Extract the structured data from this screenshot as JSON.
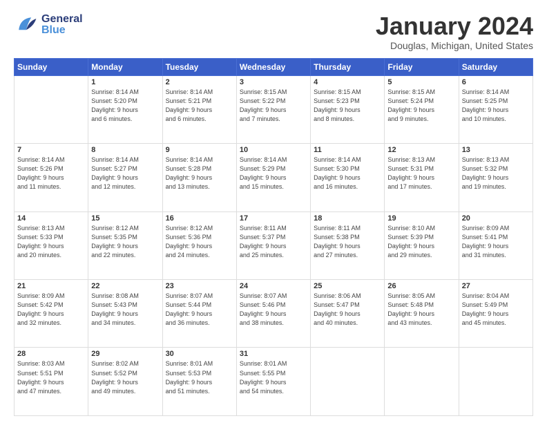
{
  "header": {
    "logo_general": "General",
    "logo_blue": "Blue",
    "month_title": "January 2024",
    "location": "Douglas, Michigan, United States"
  },
  "weekdays": [
    "Sunday",
    "Monday",
    "Tuesday",
    "Wednesday",
    "Thursday",
    "Friday",
    "Saturday"
  ],
  "weeks": [
    [
      {
        "day": "",
        "sunrise": "",
        "sunset": "",
        "daylight": ""
      },
      {
        "day": "1",
        "sunrise": "Sunrise: 8:14 AM",
        "sunset": "Sunset: 5:20 PM",
        "daylight": "Daylight: 9 hours and 6 minutes."
      },
      {
        "day": "2",
        "sunrise": "Sunrise: 8:14 AM",
        "sunset": "Sunset: 5:21 PM",
        "daylight": "Daylight: 9 hours and 6 minutes."
      },
      {
        "day": "3",
        "sunrise": "Sunrise: 8:15 AM",
        "sunset": "Sunset: 5:22 PM",
        "daylight": "Daylight: 9 hours and 7 minutes."
      },
      {
        "day": "4",
        "sunrise": "Sunrise: 8:15 AM",
        "sunset": "Sunset: 5:23 PM",
        "daylight": "Daylight: 9 hours and 8 minutes."
      },
      {
        "day": "5",
        "sunrise": "Sunrise: 8:15 AM",
        "sunset": "Sunset: 5:24 PM",
        "daylight": "Daylight: 9 hours and 9 minutes."
      },
      {
        "day": "6",
        "sunrise": "Sunrise: 8:14 AM",
        "sunset": "Sunset: 5:25 PM",
        "daylight": "Daylight: 9 hours and 10 minutes."
      }
    ],
    [
      {
        "day": "7",
        "sunrise": "Sunrise: 8:14 AM",
        "sunset": "Sunset: 5:26 PM",
        "daylight": "Daylight: 9 hours and 11 minutes."
      },
      {
        "day": "8",
        "sunrise": "Sunrise: 8:14 AM",
        "sunset": "Sunset: 5:27 PM",
        "daylight": "Daylight: 9 hours and 12 minutes."
      },
      {
        "day": "9",
        "sunrise": "Sunrise: 8:14 AM",
        "sunset": "Sunset: 5:28 PM",
        "daylight": "Daylight: 9 hours and 13 minutes."
      },
      {
        "day": "10",
        "sunrise": "Sunrise: 8:14 AM",
        "sunset": "Sunset: 5:29 PM",
        "daylight": "Daylight: 9 hours and 15 minutes."
      },
      {
        "day": "11",
        "sunrise": "Sunrise: 8:14 AM",
        "sunset": "Sunset: 5:30 PM",
        "daylight": "Daylight: 9 hours and 16 minutes."
      },
      {
        "day": "12",
        "sunrise": "Sunrise: 8:13 AM",
        "sunset": "Sunset: 5:31 PM",
        "daylight": "Daylight: 9 hours and 17 minutes."
      },
      {
        "day": "13",
        "sunrise": "Sunrise: 8:13 AM",
        "sunset": "Sunset: 5:32 PM",
        "daylight": "Daylight: 9 hours and 19 minutes."
      }
    ],
    [
      {
        "day": "14",
        "sunrise": "Sunrise: 8:13 AM",
        "sunset": "Sunset: 5:33 PM",
        "daylight": "Daylight: 9 hours and 20 minutes."
      },
      {
        "day": "15",
        "sunrise": "Sunrise: 8:12 AM",
        "sunset": "Sunset: 5:35 PM",
        "daylight": "Daylight: 9 hours and 22 minutes."
      },
      {
        "day": "16",
        "sunrise": "Sunrise: 8:12 AM",
        "sunset": "Sunset: 5:36 PM",
        "daylight": "Daylight: 9 hours and 24 minutes."
      },
      {
        "day": "17",
        "sunrise": "Sunrise: 8:11 AM",
        "sunset": "Sunset: 5:37 PM",
        "daylight": "Daylight: 9 hours and 25 minutes."
      },
      {
        "day": "18",
        "sunrise": "Sunrise: 8:11 AM",
        "sunset": "Sunset: 5:38 PM",
        "daylight": "Daylight: 9 hours and 27 minutes."
      },
      {
        "day": "19",
        "sunrise": "Sunrise: 8:10 AM",
        "sunset": "Sunset: 5:39 PM",
        "daylight": "Daylight: 9 hours and 29 minutes."
      },
      {
        "day": "20",
        "sunrise": "Sunrise: 8:09 AM",
        "sunset": "Sunset: 5:41 PM",
        "daylight": "Daylight: 9 hours and 31 minutes."
      }
    ],
    [
      {
        "day": "21",
        "sunrise": "Sunrise: 8:09 AM",
        "sunset": "Sunset: 5:42 PM",
        "daylight": "Daylight: 9 hours and 32 minutes."
      },
      {
        "day": "22",
        "sunrise": "Sunrise: 8:08 AM",
        "sunset": "Sunset: 5:43 PM",
        "daylight": "Daylight: 9 hours and 34 minutes."
      },
      {
        "day": "23",
        "sunrise": "Sunrise: 8:07 AM",
        "sunset": "Sunset: 5:44 PM",
        "daylight": "Daylight: 9 hours and 36 minutes."
      },
      {
        "day": "24",
        "sunrise": "Sunrise: 8:07 AM",
        "sunset": "Sunset: 5:46 PM",
        "daylight": "Daylight: 9 hours and 38 minutes."
      },
      {
        "day": "25",
        "sunrise": "Sunrise: 8:06 AM",
        "sunset": "Sunset: 5:47 PM",
        "daylight": "Daylight: 9 hours and 40 minutes."
      },
      {
        "day": "26",
        "sunrise": "Sunrise: 8:05 AM",
        "sunset": "Sunset: 5:48 PM",
        "daylight": "Daylight: 9 hours and 43 minutes."
      },
      {
        "day": "27",
        "sunrise": "Sunrise: 8:04 AM",
        "sunset": "Sunset: 5:49 PM",
        "daylight": "Daylight: 9 hours and 45 minutes."
      }
    ],
    [
      {
        "day": "28",
        "sunrise": "Sunrise: 8:03 AM",
        "sunset": "Sunset: 5:51 PM",
        "daylight": "Daylight: 9 hours and 47 minutes."
      },
      {
        "day": "29",
        "sunrise": "Sunrise: 8:02 AM",
        "sunset": "Sunset: 5:52 PM",
        "daylight": "Daylight: 9 hours and 49 minutes."
      },
      {
        "day": "30",
        "sunrise": "Sunrise: 8:01 AM",
        "sunset": "Sunset: 5:53 PM",
        "daylight": "Daylight: 9 hours and 51 minutes."
      },
      {
        "day": "31",
        "sunrise": "Sunrise: 8:01 AM",
        "sunset": "Sunset: 5:55 PM",
        "daylight": "Daylight: 9 hours and 54 minutes."
      },
      {
        "day": "",
        "sunrise": "",
        "sunset": "",
        "daylight": ""
      },
      {
        "day": "",
        "sunrise": "",
        "sunset": "",
        "daylight": ""
      },
      {
        "day": "",
        "sunrise": "",
        "sunset": "",
        "daylight": ""
      }
    ]
  ]
}
